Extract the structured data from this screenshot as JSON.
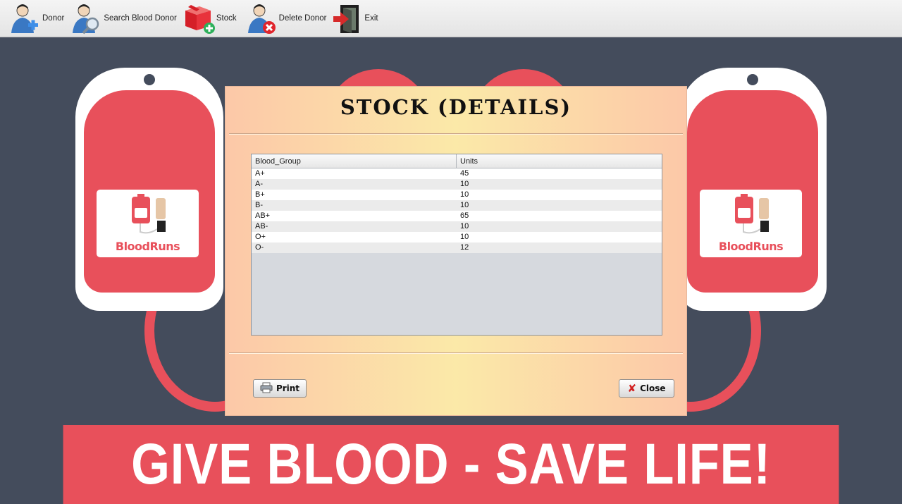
{
  "toolbar": {
    "items": [
      {
        "label": "Donor",
        "icon": "add-user-icon"
      },
      {
        "label": "Search Blood Donor",
        "icon": "search-user-icon"
      },
      {
        "label": "Stock",
        "icon": "stock-box-icon"
      },
      {
        "label": "Delete Donor",
        "icon": "delete-user-icon"
      },
      {
        "label": "Exit",
        "icon": "exit-door-icon"
      }
    ]
  },
  "poster": {
    "brand": "BloodRuns",
    "banner": "GIVE BLOOD - SAVE LIFE!",
    "colors": {
      "accent": "#e8505b",
      "background": "#444c5c"
    }
  },
  "dialog": {
    "title": "STOCK (DETAILS)",
    "table": {
      "columns": [
        "Blood_Group",
        "Units"
      ],
      "rows": [
        [
          "A+",
          "45"
        ],
        [
          "A-",
          "10"
        ],
        [
          "B+",
          "10"
        ],
        [
          "B-",
          "10"
        ],
        [
          "AB+",
          "65"
        ],
        [
          "AB-",
          "10"
        ],
        [
          "O+",
          "10"
        ],
        [
          "O-",
          "12"
        ]
      ]
    },
    "print_label": "Print",
    "close_label": "Close"
  }
}
